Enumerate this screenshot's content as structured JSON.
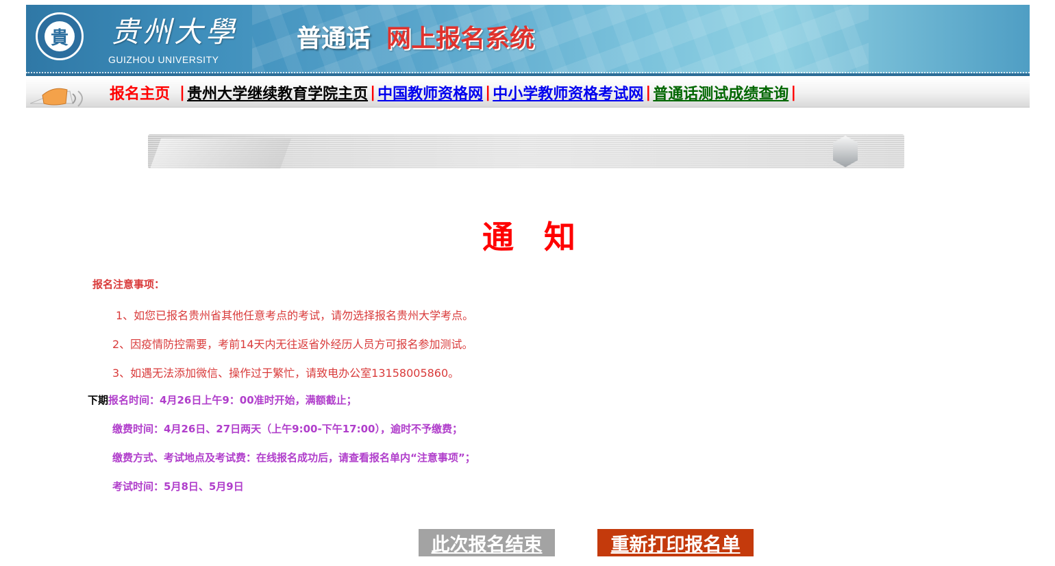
{
  "header": {
    "university_cn": "贵州大學",
    "university_en": "GUIZHOU UNIVERSITY",
    "seal_char": "貴",
    "system_title_part1": "普通话",
    "system_title_part2": "网上报名系统"
  },
  "nav": {
    "home": "报名主页",
    "separator": "|",
    "continuing_edu": "贵州大学继续教育学院主页",
    "china_teacher": "中国教师资格网",
    "school_teacher_exam": "中小学教师资格考试网",
    "score_query": "普通话测试成绩查询"
  },
  "notice": {
    "title": "通 知",
    "notes_title": "报名注意事项：",
    "note1": "1、如您已报名贵州省其他任意考点的考试，请勿选择报名贵州大学考点。",
    "note2": "2、因疫情防控需要，考前14天内无往返省外经历人员方可报名参加测试。",
    "note3": "3、如遇无法添加微信、操作过于繁忙，请致电办公室13158005860。",
    "period_label": "下期",
    "registration_time": "报名时间：4月26日上午9：00准时开始，满额截止；",
    "payment_time": "缴费时间：4月26日、27日两天（上午9:00-下午17:00），逾时不予缴费；",
    "payment_method": "缴费方式、考试地点及考试费：在线报名成功后，请查看报名单内“注意事项”；",
    "exam_time": "考试时间：5月8日、5月9日"
  },
  "buttons": {
    "end": "此次报名结束",
    "reprint": "重新打印报名单"
  },
  "colors": {
    "header_blue": "#3f8fbc",
    "notice_red": "#ff0000",
    "note_red": "#d93a3a",
    "purple": "#b03ecb",
    "button_gray": "#a3a3a3",
    "button_orange": "#c43a0c"
  }
}
